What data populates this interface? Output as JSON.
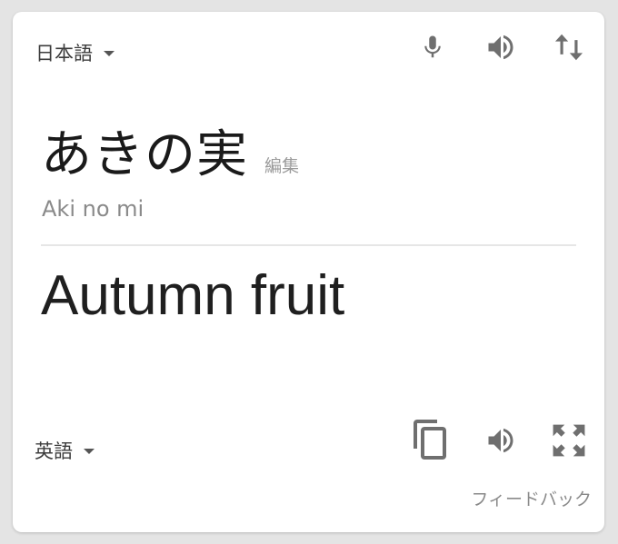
{
  "source": {
    "language": "日本語",
    "text": "あきの実",
    "edit_label": "編集",
    "romanization": "Aki no mi"
  },
  "target": {
    "language": "英語",
    "text": "Autumn fruit"
  },
  "icons": {
    "source_toolbar": [
      "microphone-icon",
      "speaker-icon",
      "swap-languages-icon"
    ],
    "target_toolbar": [
      "copy-icon",
      "speaker-icon",
      "fullscreen-icon"
    ]
  },
  "feedback_label": "フィードバック",
  "colors": {
    "icon": "#6f6f6f",
    "text_primary": "#1f1f1f",
    "text_secondary": "#8a8a8a",
    "divider": "#e6e6e6"
  }
}
